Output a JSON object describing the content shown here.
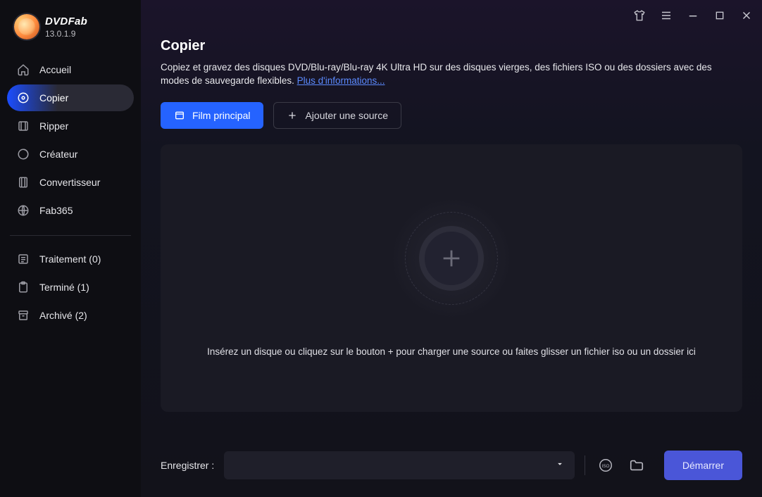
{
  "brand": {
    "name": "DVDFab",
    "version": "13.0.1.9"
  },
  "sidebar": {
    "items": [
      {
        "label": "Accueil"
      },
      {
        "label": "Copier"
      },
      {
        "label": "Ripper"
      },
      {
        "label": "Créateur"
      },
      {
        "label": "Convertisseur"
      },
      {
        "label": "Fab365"
      }
    ],
    "status": [
      {
        "label": "Traitement (0)"
      },
      {
        "label": "Terminé (1)"
      },
      {
        "label": "Archivé (2)"
      }
    ]
  },
  "page": {
    "title": "Copier",
    "description_pre": "Copiez et gravez des disques DVD/Blu-ray/Blu-ray 4K Ultra HD sur des disques vierges, des fichiers ISO ou des dossiers avec des modes de sauvegarde flexibles. ",
    "more_link": "Plus d'informations..."
  },
  "actions": {
    "primary": "Film principal",
    "add_source": "Ajouter une source"
  },
  "dropzone": {
    "help": "Insérez un disque ou cliquez sur le bouton +  pour charger une source ou faites glisser un fichier iso ou un dossier ici"
  },
  "footer": {
    "save_label": "Enregistrer :",
    "start": "Démarrer"
  }
}
